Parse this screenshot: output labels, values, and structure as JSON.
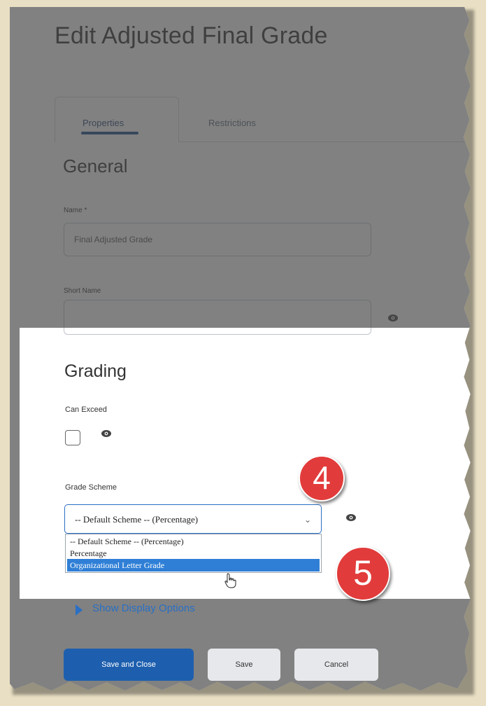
{
  "page": {
    "title": "Edit Adjusted Final Grade"
  },
  "tabs": [
    {
      "label": "Properties",
      "active": true
    },
    {
      "label": "Restrictions",
      "active": false
    }
  ],
  "general": {
    "heading": "General",
    "name_label": "Name *",
    "name_value": "Final Adjusted Grade",
    "short_name_label": "Short Name",
    "short_name_value": ""
  },
  "grading": {
    "heading": "Grading",
    "can_exceed_label": "Can Exceed",
    "can_exceed_checked": false,
    "grade_scheme_label": "Grade Scheme",
    "grade_scheme_selected": "-- Default Scheme -- (Percentage)",
    "options": [
      "-- Default Scheme -- (Percentage)",
      "Percentage",
      "Organizational Letter Grade"
    ],
    "highlighted_option": "Organizational Letter Grade"
  },
  "callouts": {
    "step_4": "4",
    "step_5": "5",
    "color": "#e23b3b"
  },
  "display_options": {
    "link_label": "Show Display Options",
    "icon": "triangle-right-icon"
  },
  "actions": {
    "save_and_close": "Save and Close",
    "save": "Save",
    "cancel": "Cancel"
  },
  "colors": {
    "primary": "#1d5fae",
    "link": "#2a6fc4",
    "selection": "#2f7fd6",
    "background": "#e9dfc4"
  }
}
